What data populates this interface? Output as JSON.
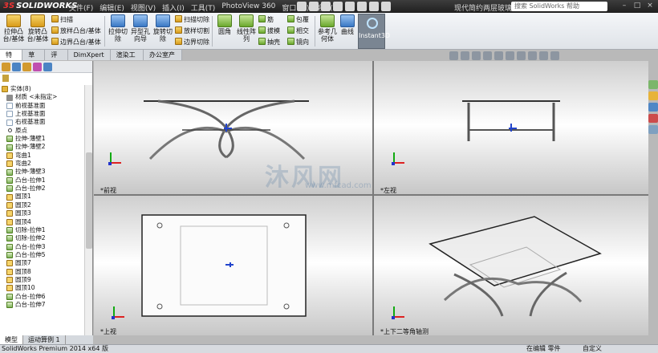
{
  "app": {
    "brand_mark": "3S",
    "title": "SOLIDWORKS",
    "window_title": "现代简约两层玻璃...",
    "search_placeholder": "搜索 SolidWorks 帮助"
  },
  "menu": [
    "文件(F)",
    "编辑(E)",
    "视图(V)",
    "插入(I)",
    "工具(T)",
    "PhotoView 360",
    "窗口(W)",
    "帮助(H)"
  ],
  "toolbar": {
    "features_big": [
      {
        "label": "拉伸凸\n台/基体",
        "icon": "extrude-boss-icon"
      },
      {
        "label": "旋转凸\n台/基体",
        "icon": "revolve-boss-icon"
      },
      {
        "label": "拉伸切\n除",
        "icon": "extrude-cut-icon"
      },
      {
        "label": "异型孔\n向导",
        "icon": "hole-wizard-icon"
      },
      {
        "label": "旋转切\n除",
        "icon": "revolve-cut-icon"
      },
      {
        "label": "圆角",
        "icon": "fillet-icon"
      },
      {
        "label": "线性阵\n列",
        "icon": "linear-pattern-icon"
      },
      {
        "label": "参考几\n何体",
        "icon": "reference-geometry-icon"
      },
      {
        "label": "曲线",
        "icon": "curves-icon"
      }
    ],
    "features_small": [
      "扫描",
      "放样凸台/基体",
      "边界凸台/基体",
      "扫描切除",
      "放样切割",
      "边界切除",
      "筋",
      "拔模",
      "抽壳",
      "包覆",
      "相交",
      "镜向"
    ],
    "instant3d": "Instant3D"
  },
  "tabs": [
    "特征",
    "草图",
    "评估",
    "DimXpert",
    "渲染工具",
    "办公室产品"
  ],
  "tree": [
    {
      "label": "实体(8)",
      "icon": "folder-icon",
      "top": true
    },
    {
      "label": "材质 <未指定>",
      "icon": "material-icon"
    },
    {
      "label": "前视基准面",
      "icon": "plane-icon"
    },
    {
      "label": "上视基准面",
      "icon": "plane-icon"
    },
    {
      "label": "右视基准面",
      "icon": "plane-icon"
    },
    {
      "label": "原点",
      "icon": "origin-icon"
    },
    {
      "label": "拉伸-薄壁1",
      "icon": "feature-icon"
    },
    {
      "label": "拉伸-薄壁2",
      "icon": "feature-icon"
    },
    {
      "label": "弯曲1",
      "icon": "flex-icon"
    },
    {
      "label": "弯曲2",
      "icon": "flex-icon"
    },
    {
      "label": "拉伸-薄壁3",
      "icon": "feature-icon"
    },
    {
      "label": "凸台-拉伸1",
      "icon": "feature-icon"
    },
    {
      "label": "凸台-拉伸2",
      "icon": "feature-icon"
    },
    {
      "label": "圆顶1",
      "icon": "dome-icon"
    },
    {
      "label": "圆顶2",
      "icon": "dome-icon"
    },
    {
      "label": "圆顶3",
      "icon": "dome-icon"
    },
    {
      "label": "圆顶4",
      "icon": "dome-icon"
    },
    {
      "label": "切除-拉伸1",
      "icon": "feature-icon"
    },
    {
      "label": "切除-拉伸2",
      "icon": "feature-icon"
    },
    {
      "label": "凸台-拉伸3",
      "icon": "feature-icon"
    },
    {
      "label": "凸台-拉伸5",
      "icon": "feature-icon"
    },
    {
      "label": "圆顶7",
      "icon": "dome-icon"
    },
    {
      "label": "圆顶8",
      "icon": "dome-icon"
    },
    {
      "label": "圆顶9",
      "icon": "dome-icon"
    },
    {
      "label": "圆顶10",
      "icon": "dome-icon"
    },
    {
      "label": "凸台-拉伸6",
      "icon": "feature-icon"
    },
    {
      "label": "凸台-拉伸7",
      "icon": "feature-icon"
    }
  ],
  "bottom_tabs": [
    "模型",
    "运动算例 1"
  ],
  "viewports": {
    "front": "*前视",
    "left": "*左视",
    "top": "*上视",
    "iso": "*上下二等角轴测"
  },
  "watermark": {
    "text": "沐风网",
    "url": "www.mfcad.com"
  },
  "status": {
    "left": "SolidWorks Premium 2014 x64 版",
    "mode": "在编辑 零件",
    "custom": "自定义"
  }
}
